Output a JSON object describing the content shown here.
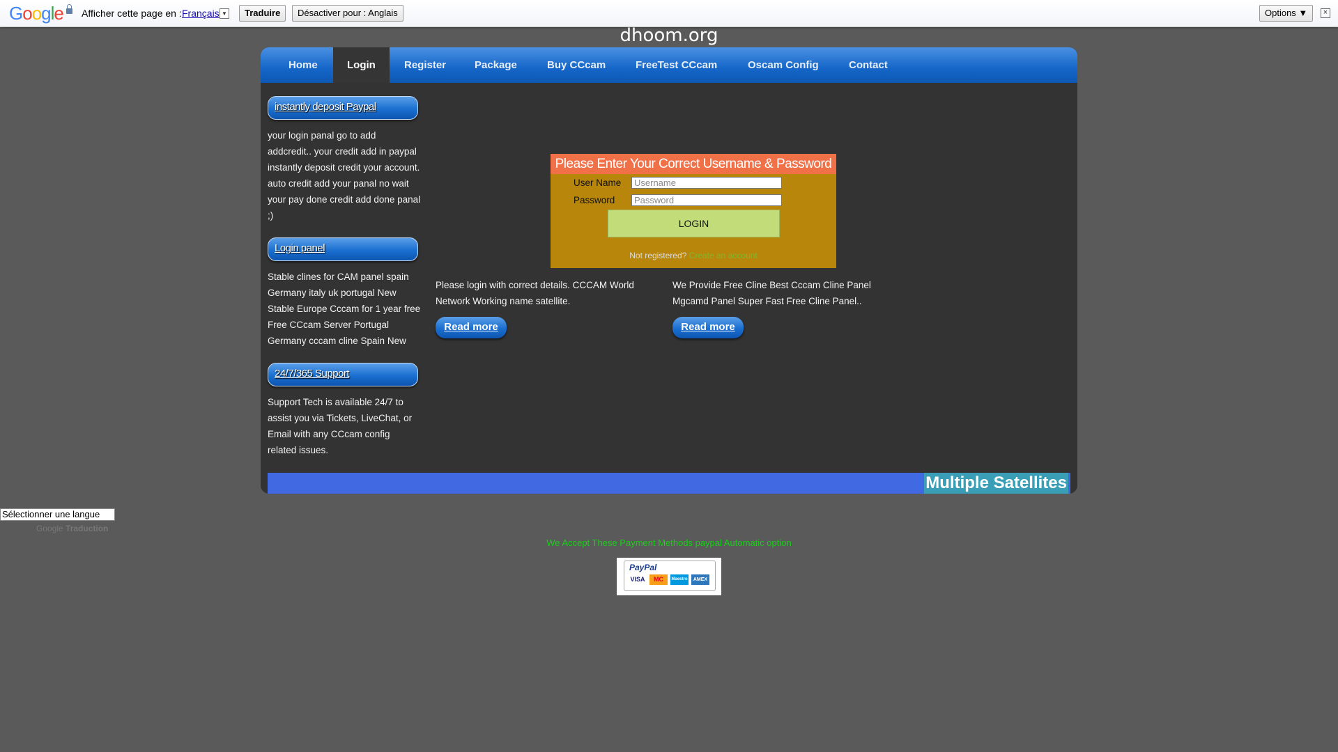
{
  "translate_bar": {
    "logo": "Google",
    "prompt": "Afficher cette page en :",
    "language": "Français",
    "translate_button": "Traduire",
    "disable_button": "Désactiver pour : Anglais",
    "options_button": "Options ▼",
    "close": "×"
  },
  "site": {
    "title": "dhoom.org"
  },
  "nav": {
    "items": [
      {
        "label": "Home"
      },
      {
        "label": "Login"
      },
      {
        "label": "Register"
      },
      {
        "label": "Package"
      },
      {
        "label": "Buy CCcam"
      },
      {
        "label": "FreeTest CCcam"
      },
      {
        "label": "Oscam Config"
      },
      {
        "label": "Contact"
      }
    ],
    "active": "Login"
  },
  "sidebar": {
    "sections": [
      {
        "title": "instantly deposit Paypal",
        "text": "your login panal go to add addcredit.. your credit add in paypal instantly deposit credit your account. auto credit add your panal no wait your pay done credit add done panal ;)"
      },
      {
        "title": "Login panel",
        "text": "Stable clines for CAM panel spain Germany italy uk portugal New Stable Europe Cccam for 1 year free Free CCcam Server Portugal Germany cccam cline Spain New"
      },
      {
        "title": "24/7/365 Support",
        "text": "Support Tech is available 24/7 to assist you via Tickets, LiveChat, or Email with any CCcam config related issues."
      }
    ]
  },
  "login": {
    "heading": "Please Enter Your Correct Username & Password",
    "username_label": "User Name",
    "username_placeholder": "Username",
    "password_label": "Password",
    "password_placeholder": "Password",
    "button": "LOGIN",
    "not_registered": "Not registered?",
    "create_account": "Create an account"
  },
  "columns": [
    {
      "text": "Please login with correct details. CCCAM World Network Working name satellite.",
      "button": "Read more"
    },
    {
      "text": "We Provide Free Cline Best Cccam Cline Panel Mgcamd Panel Super Fast Free Cline Panel..",
      "button": "Read more"
    }
  ],
  "banner": {
    "text": "Multiple Satellites"
  },
  "language_select": {
    "selected": "Sélectionner une langue"
  },
  "powered_by": {
    "google": "Google",
    "label": "Traduction"
  },
  "payment": {
    "text": "We Accept These Payment Methods paypal Automatic option",
    "paypal_logo": "PayPal",
    "cards": [
      "VISA",
      "MC",
      "Maestro",
      "AMEX"
    ]
  },
  "colors": {
    "page_bg": "#5a5a5a",
    "container_bg": "#333333",
    "nav_blue": "#1466c8",
    "login_bg": "#b8860b",
    "login_header": "#f07048",
    "login_button": "#c1dc78",
    "banner": "#4169e1",
    "payment_text": "#19cf19"
  }
}
